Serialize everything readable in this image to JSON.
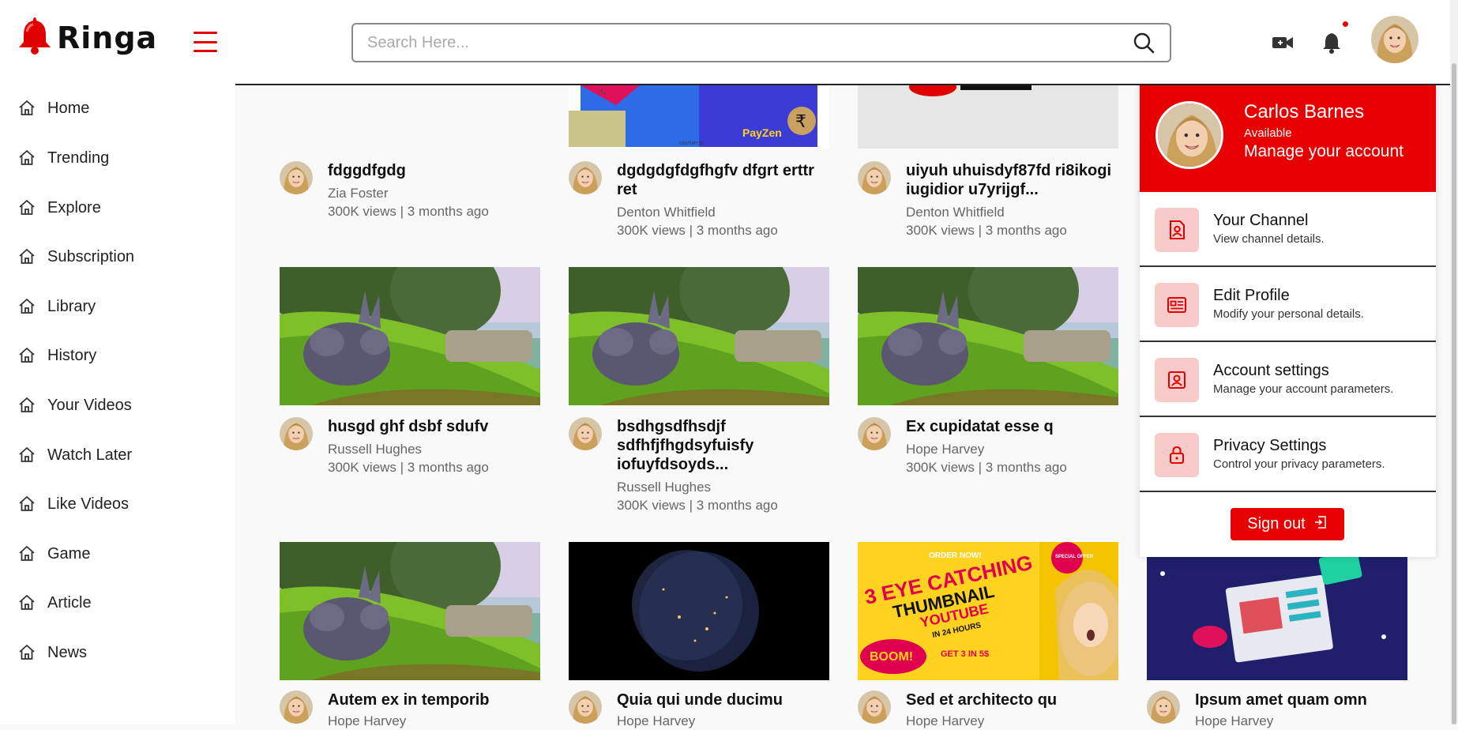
{
  "app": {
    "logo_text": "Ringa"
  },
  "search": {
    "placeholder": "Search Here..."
  },
  "sidebar": {
    "items": [
      {
        "label": "Home"
      },
      {
        "label": "Trending"
      },
      {
        "label": "Explore"
      },
      {
        "label": "Subscription"
      },
      {
        "label": "Library"
      },
      {
        "label": "History"
      },
      {
        "label": "Your Videos"
      },
      {
        "label": "Watch Later"
      },
      {
        "label": "Like Videos"
      },
      {
        "label": "Game"
      },
      {
        "label": "Article"
      },
      {
        "label": "News"
      }
    ]
  },
  "videos": [
    {
      "title": "fdggdfgdg",
      "author": "Zia Foster",
      "stats": "300K views | 3 months ago"
    },
    {
      "title": "dgdgdgfdgfhgfv dfgrt erttr ret",
      "author": "Denton Whitfield",
      "stats": "300K views | 3 months ago"
    },
    {
      "title": "uiyuh uhuisdyf87fd ri8ikogi iugidior u7yrijgf...",
      "author": "Denton Whitfield",
      "stats": "300K views | 3 months ago"
    },
    {
      "title": "husgd ghf dsbf sdufv",
      "author": "Russell Hughes",
      "stats": "300K views | 3 months ago"
    },
    {
      "title": "bsdhgsdfhsdjf sdfhfjfhgdsyfuisfy iofuyfdsoyds...",
      "author": "Russell Hughes",
      "stats": "300K views | 3 months ago"
    },
    {
      "title": "Ex cupidatat esse q",
      "author": "Hope Harvey",
      "stats": "300K views | 3 months ago"
    },
    {
      "title": "Autem ex in temporib",
      "author": "Hope Harvey",
      "stats": ""
    },
    {
      "title": "Quia qui unde ducimu",
      "author": "Hope Harvey",
      "stats": ""
    },
    {
      "title": "Sed et architecto qu",
      "author": "Hope Harvey",
      "stats": ""
    },
    {
      "title": "Ipsum amet quam omn",
      "author": "Hope Harvey",
      "stats": ""
    }
  ],
  "thumb_texts": {
    "ad1_line1": "ORDER NOW!",
    "ad1_line2": "3 EYE CATCHING",
    "ad1_line3": "THUMBNAIL",
    "ad1_line4": "YOUTUBE",
    "ad1_line5": "IN 24 HOURS",
    "ad1_boom": "BOOM!",
    "ad1_get": "GET 3 IN 5$",
    "ad1_badge": "SPECIAL OFFER",
    "pay_brand": "PayZen",
    "pay_century": "CENTURY 21"
  },
  "profile": {
    "name": "Carlos Barnes",
    "status": "Available",
    "manage": "Manage your account",
    "menu": [
      {
        "title": "Your Channel",
        "subtitle": "View channel details."
      },
      {
        "title": "Edit Profile",
        "subtitle": "Modify your personal details."
      },
      {
        "title": "Account settings",
        "subtitle": "Manage your account parameters."
      },
      {
        "title": "Privacy Settings",
        "subtitle": "Control your privacy parameters."
      }
    ],
    "signout": "Sign out"
  },
  "colors": {
    "brand": "#e80000",
    "panel_icon_bg": "#f8caca"
  },
  "icons": [
    "bell-logo-icon",
    "hamburger-icon",
    "search-icon",
    "video-camera-icon",
    "bell-icon",
    "home-icon",
    "user-square-icon",
    "id-card-icon",
    "user-box-icon",
    "lock-icon",
    "sign-out-icon"
  ]
}
